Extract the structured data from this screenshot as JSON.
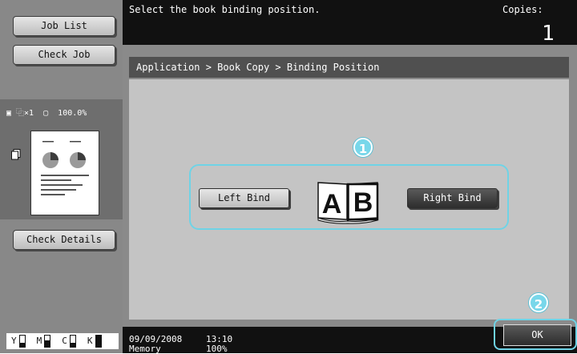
{
  "sidebar": {
    "job_list_label": "Job List",
    "check_job_label": "Check Job",
    "preview_status": "▣ ⿻×1  ▢  100.0%",
    "check_details_label": "Check Details",
    "toners": [
      {
        "label": "Y",
        "level": 0.35
      },
      {
        "label": "M",
        "level": 0.6
      },
      {
        "label": "C",
        "level": 0.35
      },
      {
        "label": "K",
        "level": 1.0
      }
    ]
  },
  "header": {
    "message": "Select the book binding position.",
    "copies_label": "Copies:",
    "copies_value": "1"
  },
  "breadcrumb": "Application > Book Copy > Binding Position",
  "binding": {
    "left_label": "Left Bind",
    "right_label": "Right Bind",
    "book_letters": [
      "A",
      "B"
    ],
    "selected": "Right Bind"
  },
  "callouts": {
    "one": "1",
    "two": "2"
  },
  "footer": {
    "date": "09/09/2008",
    "time": "13:10",
    "memory_label": "Memory",
    "memory_value": "100%",
    "ok_label": "OK"
  },
  "colors": {
    "accent": "#6fd3e6",
    "panel": "#8a8a8a",
    "content": "#c4c4c4",
    "dark": "#111111"
  }
}
